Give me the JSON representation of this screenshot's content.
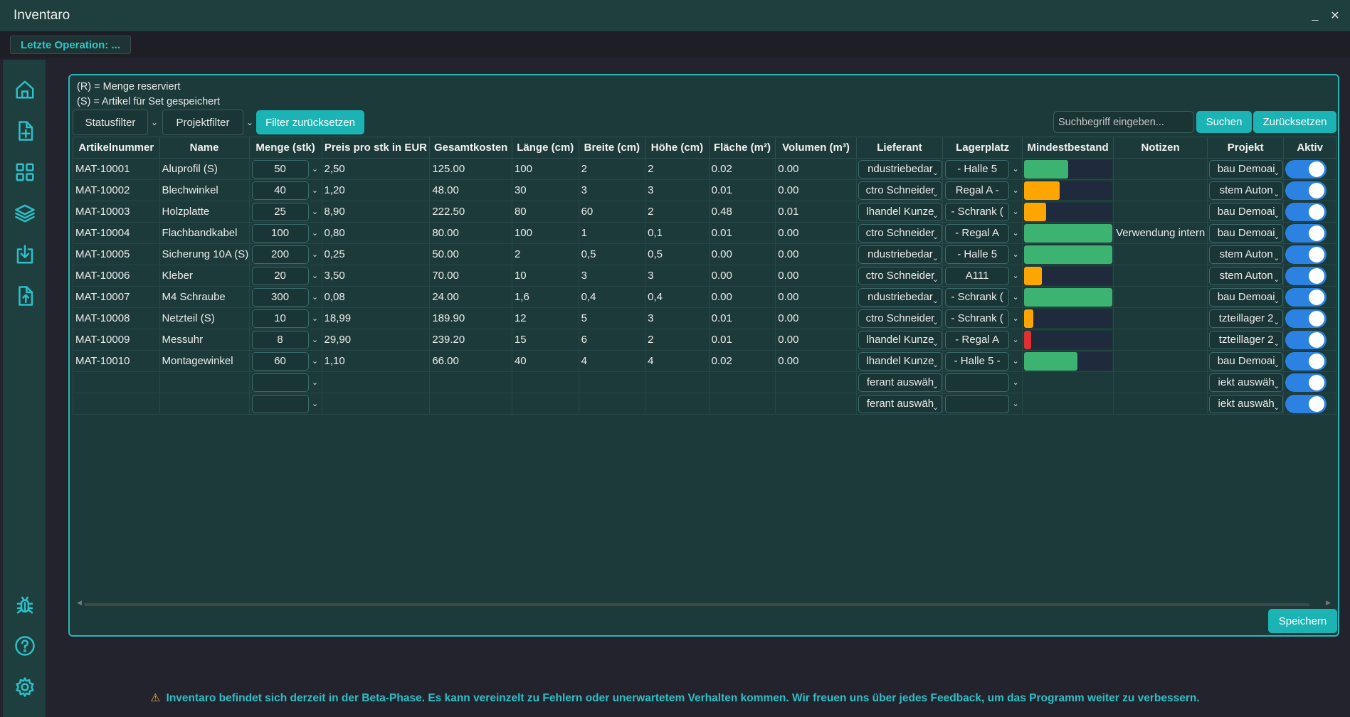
{
  "window": {
    "title": "Inventaro",
    "minimize": "_",
    "close": "✕"
  },
  "status": {
    "last_operation": "Letzte Operation: ..."
  },
  "sidebar": [
    "home-icon",
    "new-file-icon",
    "grid-icon",
    "layers-icon",
    "import-icon",
    "export-icon",
    "bug-icon",
    "help-icon",
    "gear-icon"
  ],
  "legend": {
    "r": "(R) = Menge reserviert",
    "s": "(S) = Artikel für Set gespeichert"
  },
  "filters": {
    "status": "Statusfilter",
    "project": "Projektfilter",
    "reset": "Filter zurücksetzen"
  },
  "search": {
    "placeholder": "Suchbegriff eingeben...",
    "search_button": "Suchen",
    "reset_button": "Zurücksetzen"
  },
  "columns": [
    "Artikelnummer",
    "Name",
    "Menge (stk)",
    "Preis pro stk in EUR",
    "Gesamtkosten",
    "Länge (cm)",
    "Breite (cm)",
    "Höhe (cm)",
    "Fläche (m²)",
    "Volumen (m³)",
    "Lieferant",
    "Lagerplatz",
    "Mindestbestand",
    "Notizen",
    "Projekt",
    "Aktiv"
  ],
  "rows": [
    {
      "nr": "MAT-10001",
      "name": "Aluprofil (S)",
      "menge": "50",
      "preis": "2,50",
      "gesamt": "125.00",
      "laenge": "100",
      "breite": "2",
      "hoehe": "2",
      "flaeche": "0.02",
      "volumen": "0.00",
      "lieferant": "ndustriebedar",
      "lager": "- Halle 5",
      "stock": 0.5,
      "stock_color": "#3cb371",
      "notiz": "",
      "projekt": "bau Demoai"
    },
    {
      "nr": "MAT-10002",
      "name": "Blechwinkel",
      "menge": "40",
      "preis": "1,20",
      "gesamt": "48.00",
      "laenge": "30",
      "breite": "3",
      "hoehe": "3",
      "flaeche": "0.01",
      "volumen": "0.00",
      "lieferant": "ctro Schneider",
      "lager": "Regal A -",
      "stock": 0.4,
      "stock_color": "#ffa500",
      "notiz": "",
      "projekt": "stem Auton"
    },
    {
      "nr": "MAT-10003",
      "name": "Holzplatte",
      "menge": "25",
      "preis": "8,90",
      "gesamt": "222.50",
      "laenge": "80",
      "breite": "60",
      "hoehe": "2",
      "flaeche": "0.48",
      "volumen": "0.01",
      "lieferant": "lhandel Kunze",
      "lager": "- Schrank (",
      "stock": 0.25,
      "stock_color": "#ffa500",
      "notiz": "",
      "projekt": "bau Demoai"
    },
    {
      "nr": "MAT-10004",
      "name": "Flachbandkabel",
      "menge": "100",
      "preis": "0,80",
      "gesamt": "80.00",
      "laenge": "100",
      "breite": "1",
      "hoehe": "0,1",
      "flaeche": "0.01",
      "volumen": "0.00",
      "lieferant": "ctro Schneider",
      "lager": "- Regal A",
      "stock": 1.0,
      "stock_color": "#3cb371",
      "notiz": "Verwendung intern",
      "projekt": "bau Demoai"
    },
    {
      "nr": "MAT-10005",
      "name": "Sicherung 10A (S)",
      "menge": "200",
      "preis": "0,25",
      "gesamt": "50.00",
      "laenge": "2",
      "breite": "0,5",
      "hoehe": "0,5",
      "flaeche": "0.00",
      "volumen": "0.00",
      "lieferant": "ndustriebedar",
      "lager": "- Halle 5",
      "stock": 1.0,
      "stock_color": "#3cb371",
      "notiz": "",
      "projekt": "stem Auton"
    },
    {
      "nr": "MAT-10006",
      "name": "Kleber",
      "menge": "20",
      "preis": "3,50",
      "gesamt": "70.00",
      "laenge": "10",
      "breite": "3",
      "hoehe": "3",
      "flaeche": "0.00",
      "volumen": "0.00",
      "lieferant": "ctro Schneider",
      "lager": "A111",
      "stock": 0.2,
      "stock_color": "#ffa500",
      "notiz": "",
      "projekt": "stem Auton"
    },
    {
      "nr": "MAT-10007",
      "name": "M4 Schraube",
      "menge": "300",
      "preis": "0,08",
      "gesamt": "24.00",
      "laenge": "1,6",
      "breite": "0,4",
      "hoehe": "0,4",
      "flaeche": "0.00",
      "volumen": "0.00",
      "lieferant": "ndustriebedar",
      "lager": "- Schrank (",
      "stock": 1.0,
      "stock_color": "#3cb371",
      "notiz": "",
      "projekt": "bau Demoai"
    },
    {
      "nr": "MAT-10008",
      "name": "Netzteil (S)",
      "menge": "10",
      "preis": "18,99",
      "gesamt": "189.90",
      "laenge": "12",
      "breite": "5",
      "hoehe": "3",
      "flaeche": "0.01",
      "volumen": "0.00",
      "lieferant": "ctro Schneider",
      "lager": "- Schrank (",
      "stock": 0.1,
      "stock_color": "#ffa500",
      "notiz": "",
      "projekt": "tzteillager 2"
    },
    {
      "nr": "MAT-10009",
      "name": "Messuhr",
      "menge": "8",
      "preis": "29,90",
      "gesamt": "239.20",
      "laenge": "15",
      "breite": "6",
      "hoehe": "2",
      "flaeche": "0.01",
      "volumen": "0.00",
      "lieferant": "lhandel Kunze",
      "lager": "- Regal A",
      "stock": 0.08,
      "stock_color": "#e03030",
      "notiz": "",
      "projekt": "tzteillager 2"
    },
    {
      "nr": "MAT-10010",
      "name": "Montagewinkel",
      "menge": "60",
      "preis": "1,10",
      "gesamt": "66.00",
      "laenge": "40",
      "breite": "4",
      "hoehe": "4",
      "flaeche": "0.02",
      "volumen": "0.00",
      "lieferant": "lhandel Kunze",
      "lager": "- Halle 5 -",
      "stock": 0.6,
      "stock_color": "#3cb371",
      "notiz": "",
      "projekt": "bau Demoai"
    },
    {
      "nr": "",
      "name": "",
      "menge": "",
      "preis": "",
      "gesamt": "",
      "laenge": "",
      "breite": "",
      "hoehe": "",
      "flaeche": "",
      "volumen": "",
      "lieferant": "ferant auswäh",
      "lager": "",
      "stock": null,
      "stock_color": "",
      "notiz": "",
      "projekt": "iekt auswäh"
    },
    {
      "nr": "",
      "name": "",
      "menge": "",
      "preis": "",
      "gesamt": "",
      "laenge": "",
      "breite": "",
      "hoehe": "",
      "flaeche": "",
      "volumen": "",
      "lieferant": "ferant auswäh",
      "lager": "",
      "stock": null,
      "stock_color": "",
      "notiz": "",
      "projekt": "iekt auswäh"
    }
  ],
  "save_button": "Speichern",
  "banner": {
    "icon": "⚠",
    "text": "Inventaro befindet sich derzeit in der Beta-Phase. Es kann vereinzelt zu Fehlern oder unerwartetem Verhalten kommen. Wir freuen uns über jedes Feedback, um das Programm weiter zu verbessern."
  }
}
